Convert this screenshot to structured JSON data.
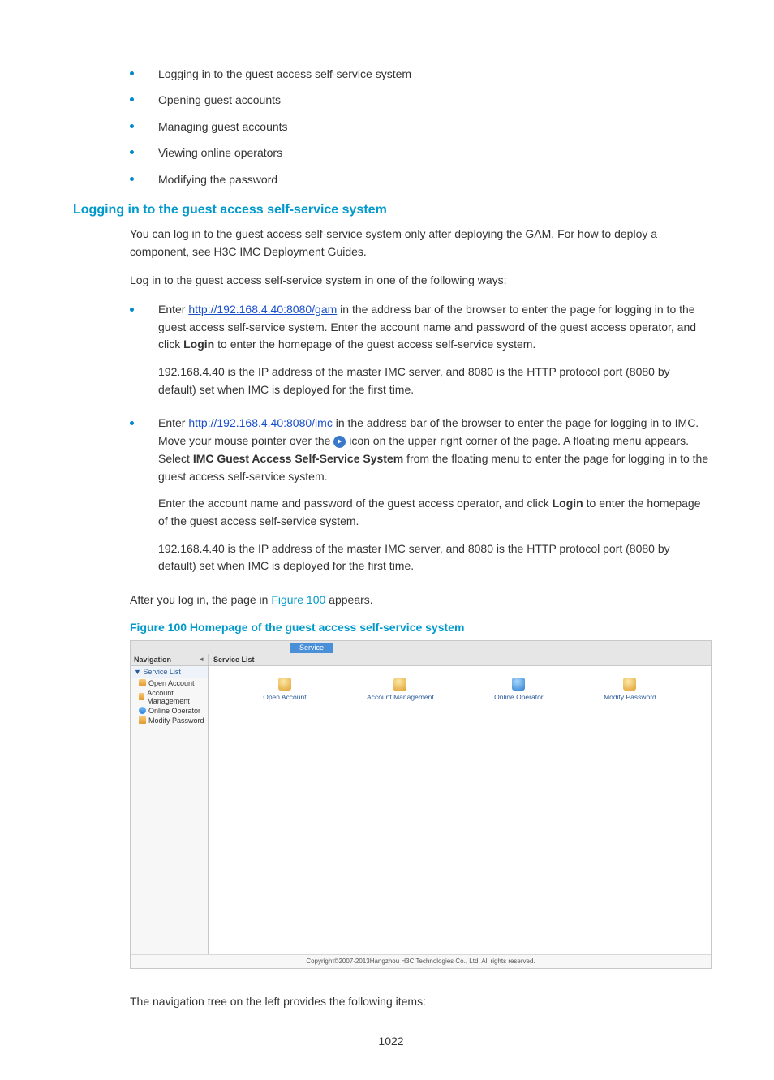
{
  "bullets_top": [
    "Logging in to the guest access self-service system",
    "Opening guest accounts",
    "Managing guest accounts",
    "Viewing online operators",
    "Modifying the password"
  ],
  "section_heading": "Logging in to the guest access self-service system",
  "para1": "You can log in to the guest access self-service system only after deploying the GAM. For how to deploy a component, see H3C IMC Deployment Guides.",
  "para2": "Log in to the guest access self-service system in one of the following ways:",
  "item1": {
    "prefix": "Enter ",
    "link": "http://192.168.4.40:8080/gam",
    "after_link": " in the address bar of the browser to enter the page for logging in to the guest access self-service system. Enter the account name and password of the guest access operator, and click ",
    "bold": "Login",
    "after_bold": " to enter the homepage of the guest access self-service system.",
    "p2": "192.168.4.40 is the IP address of the master IMC server, and 8080 is the HTTP protocol port (8080 by default) set when IMC is deployed for the first time."
  },
  "item2": {
    "prefix": "Enter ",
    "link": "http://192.168.4.40:8080/imc",
    "after_link_a": " in the address bar of the browser to enter the page for logging in to IMC. Move your mouse pointer over the ",
    "after_link_b": " icon on the upper right corner of the page. A floating menu appears. Select ",
    "bold1": "IMC Guest Access Self-Service System",
    "after_bold1": " from the floating menu to enter the page for logging in to the guest access self-service system.",
    "p2a": "Enter the account name and password of the guest access operator, and click ",
    "p2bold": "Login",
    "p2b": " to enter the homepage of the guest access self-service system.",
    "p3": "192.168.4.40 is the IP address of the master IMC server, and 8080 is the HTTP protocol port (8080 by default) set when IMC is deployed for the first time."
  },
  "para3a": "After you log in, the page in ",
  "para3ref": "Figure 100",
  "para3b": " appears.",
  "fig_caption": "Figure 100 Homepage of the guest access self-service system",
  "fig": {
    "tab": "Service",
    "nav_head": "Navigation",
    "nav_group": "▼ Service List",
    "nav_items": [
      "Open Account",
      "Account Management",
      "Online Operator",
      "Modify Password"
    ],
    "main_head": "Service List",
    "icons": [
      "Open Account",
      "Account Management",
      "Online Operator",
      "Modify Password"
    ],
    "footer": "Copyright©2007-2013Hangzhou H3C Technologies Co., Ltd. All rights reserved."
  },
  "para_after_fig": "The navigation tree on the left provides the following items:",
  "pagenum": "1022"
}
